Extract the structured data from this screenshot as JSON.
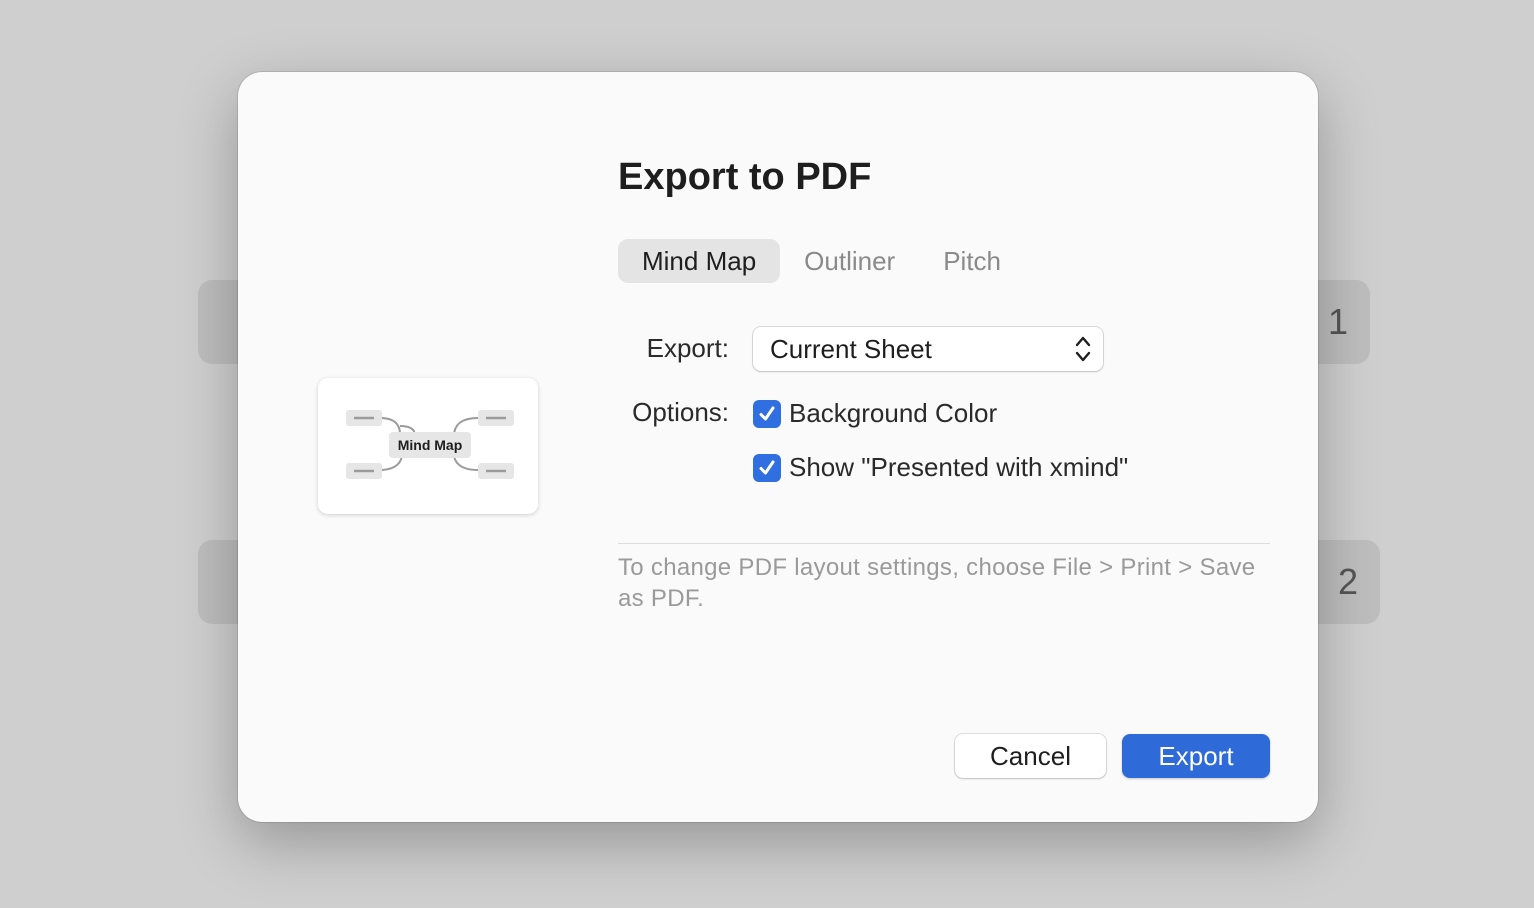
{
  "background": {
    "card1_number": "1",
    "card2_number": "2"
  },
  "dialog": {
    "title": "Export to PDF",
    "preview": {
      "central_topic": "Mind Map"
    },
    "tabs": [
      {
        "label": "Mind Map",
        "active": true
      },
      {
        "label": "Outliner",
        "active": false
      },
      {
        "label": "Pitch",
        "active": false
      }
    ],
    "export_label": "Export:",
    "export_value": "Current Sheet",
    "options_label": "Options:",
    "options": [
      {
        "label": "Background Color",
        "checked": true
      },
      {
        "label": "Show \"Presented with xmind\"",
        "checked": true
      }
    ],
    "hint": "To change PDF layout settings, choose File > Print > Save as PDF.",
    "cancel_label": "Cancel",
    "export_button_label": "Export"
  },
  "colors": {
    "accent": "#2e6ad8",
    "checkbox": "#2f6fe0",
    "backdrop": "#cfcfcf",
    "dialog_bg": "#fafafa"
  }
}
